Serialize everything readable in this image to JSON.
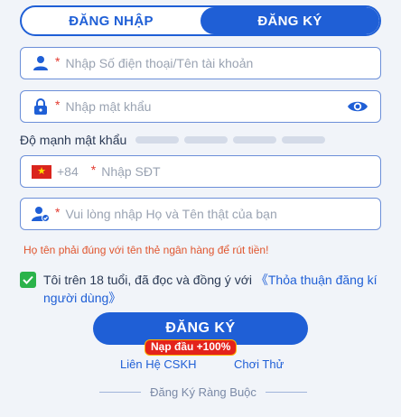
{
  "tabs": [
    {
      "label": "ĐĂNG NHẬP",
      "active": false
    },
    {
      "label": "ĐĂNG KÝ",
      "active": true
    }
  ],
  "form": {
    "username": {
      "placeholder": "Nhập Số điện thoại/Tên tài khoản",
      "value": "",
      "icon": "user-icon"
    },
    "password": {
      "placeholder": "Nhập mật khẩu",
      "value": "",
      "icon": "lock-icon",
      "toggle_icon": "eye-icon"
    },
    "strength_label": "Độ mạnh mật khẩu",
    "strength_level": 0,
    "phone": {
      "country_code": "+84",
      "placeholder": "Nhập SĐT",
      "value": "",
      "icon": "vietnam-flag-icon"
    },
    "fullname": {
      "placeholder": "Vui lòng nhập Họ và Tên thật của bạn",
      "value": "",
      "icon": "verified-user-icon"
    },
    "required_mark": "*"
  },
  "warning": "Họ tên phải đúng với tên thẻ ngân hàng để rút tiền!",
  "agreement": {
    "checked": true,
    "text": "Tôi trên 18 tuổi, đã đọc và đồng ý với ",
    "link": "《Thỏa thuận đăng kí người dùng》"
  },
  "submit_label": "ĐĂNG KÝ",
  "promo_badge": "Nạp đầu +100%",
  "links": {
    "support": "Liên Hệ CSKH",
    "trial": "Chơi Thử"
  },
  "bind_label": "Đăng Ký Ràng Buộc",
  "colors": {
    "primary": "#1f5fd6",
    "required": "#e33a2f",
    "warning": "#e0552e",
    "check": "#2bb34a",
    "promo": "#e3231b"
  }
}
